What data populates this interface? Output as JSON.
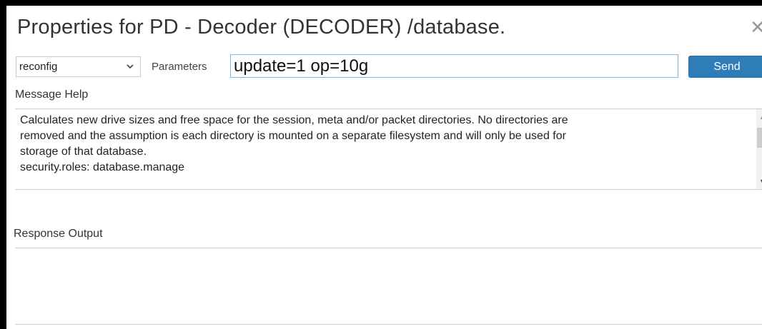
{
  "dialog": {
    "title": "Properties for PD - Decoder (DECODER) /database.",
    "close_glyph": "✕"
  },
  "toolbar": {
    "command_select": {
      "value": "reconfig",
      "arrow_glyph": "⌄"
    },
    "params_label": "Parameters",
    "params_value": "update=1 op=10g",
    "send_label": "Send",
    "send_color": "#2e7cb8"
  },
  "message_help": {
    "label": "Message Help",
    "lines": [
      "Calculates new drive sizes and free space for the session, meta and/or packet directories.  No directories are",
      "removed and the assumption is each directory is mounted on a separate filesystem and will only be used for",
      "storage of that database.",
      "security.roles: database.manage"
    ],
    "scroll_up_glyph": "▲",
    "scroll_down_glyph": "▼"
  },
  "response_output": {
    "label": "Response Output",
    "content": ""
  },
  "icons": {
    "close": "close-icon",
    "dropdown": "chevron-down-icon",
    "scroll_up": "scroll-up-icon",
    "scroll_down": "scroll-down-icon"
  }
}
